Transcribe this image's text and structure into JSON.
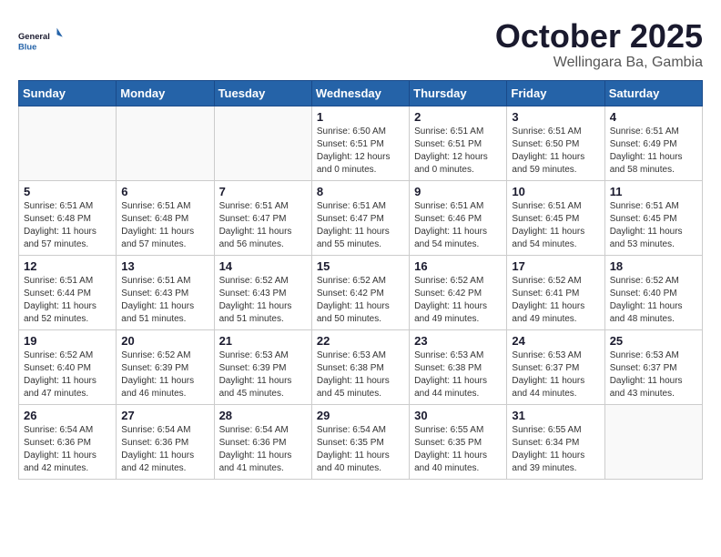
{
  "header": {
    "logo_line1": "General",
    "logo_line2": "Blue",
    "month": "October 2025",
    "location": "Wellingara Ba, Gambia"
  },
  "weekdays": [
    "Sunday",
    "Monday",
    "Tuesday",
    "Wednesday",
    "Thursday",
    "Friday",
    "Saturday"
  ],
  "weeks": [
    [
      {
        "day": "",
        "info": ""
      },
      {
        "day": "",
        "info": ""
      },
      {
        "day": "",
        "info": ""
      },
      {
        "day": "1",
        "info": "Sunrise: 6:50 AM\nSunset: 6:51 PM\nDaylight: 12 hours\nand 0 minutes."
      },
      {
        "day": "2",
        "info": "Sunrise: 6:51 AM\nSunset: 6:51 PM\nDaylight: 12 hours\nand 0 minutes."
      },
      {
        "day": "3",
        "info": "Sunrise: 6:51 AM\nSunset: 6:50 PM\nDaylight: 11 hours\nand 59 minutes."
      },
      {
        "day": "4",
        "info": "Sunrise: 6:51 AM\nSunset: 6:49 PM\nDaylight: 11 hours\nand 58 minutes."
      }
    ],
    [
      {
        "day": "5",
        "info": "Sunrise: 6:51 AM\nSunset: 6:48 PM\nDaylight: 11 hours\nand 57 minutes."
      },
      {
        "day": "6",
        "info": "Sunrise: 6:51 AM\nSunset: 6:48 PM\nDaylight: 11 hours\nand 57 minutes."
      },
      {
        "day": "7",
        "info": "Sunrise: 6:51 AM\nSunset: 6:47 PM\nDaylight: 11 hours\nand 56 minutes."
      },
      {
        "day": "8",
        "info": "Sunrise: 6:51 AM\nSunset: 6:47 PM\nDaylight: 11 hours\nand 55 minutes."
      },
      {
        "day": "9",
        "info": "Sunrise: 6:51 AM\nSunset: 6:46 PM\nDaylight: 11 hours\nand 54 minutes."
      },
      {
        "day": "10",
        "info": "Sunrise: 6:51 AM\nSunset: 6:45 PM\nDaylight: 11 hours\nand 54 minutes."
      },
      {
        "day": "11",
        "info": "Sunrise: 6:51 AM\nSunset: 6:45 PM\nDaylight: 11 hours\nand 53 minutes."
      }
    ],
    [
      {
        "day": "12",
        "info": "Sunrise: 6:51 AM\nSunset: 6:44 PM\nDaylight: 11 hours\nand 52 minutes."
      },
      {
        "day": "13",
        "info": "Sunrise: 6:51 AM\nSunset: 6:43 PM\nDaylight: 11 hours\nand 51 minutes."
      },
      {
        "day": "14",
        "info": "Sunrise: 6:52 AM\nSunset: 6:43 PM\nDaylight: 11 hours\nand 51 minutes."
      },
      {
        "day": "15",
        "info": "Sunrise: 6:52 AM\nSunset: 6:42 PM\nDaylight: 11 hours\nand 50 minutes."
      },
      {
        "day": "16",
        "info": "Sunrise: 6:52 AM\nSunset: 6:42 PM\nDaylight: 11 hours\nand 49 minutes."
      },
      {
        "day": "17",
        "info": "Sunrise: 6:52 AM\nSunset: 6:41 PM\nDaylight: 11 hours\nand 49 minutes."
      },
      {
        "day": "18",
        "info": "Sunrise: 6:52 AM\nSunset: 6:40 PM\nDaylight: 11 hours\nand 48 minutes."
      }
    ],
    [
      {
        "day": "19",
        "info": "Sunrise: 6:52 AM\nSunset: 6:40 PM\nDaylight: 11 hours\nand 47 minutes."
      },
      {
        "day": "20",
        "info": "Sunrise: 6:52 AM\nSunset: 6:39 PM\nDaylight: 11 hours\nand 46 minutes."
      },
      {
        "day": "21",
        "info": "Sunrise: 6:53 AM\nSunset: 6:39 PM\nDaylight: 11 hours\nand 45 minutes."
      },
      {
        "day": "22",
        "info": "Sunrise: 6:53 AM\nSunset: 6:38 PM\nDaylight: 11 hours\nand 45 minutes."
      },
      {
        "day": "23",
        "info": "Sunrise: 6:53 AM\nSunset: 6:38 PM\nDaylight: 11 hours\nand 44 minutes."
      },
      {
        "day": "24",
        "info": "Sunrise: 6:53 AM\nSunset: 6:37 PM\nDaylight: 11 hours\nand 44 minutes."
      },
      {
        "day": "25",
        "info": "Sunrise: 6:53 AM\nSunset: 6:37 PM\nDaylight: 11 hours\nand 43 minutes."
      }
    ],
    [
      {
        "day": "26",
        "info": "Sunrise: 6:54 AM\nSunset: 6:36 PM\nDaylight: 11 hours\nand 42 minutes."
      },
      {
        "day": "27",
        "info": "Sunrise: 6:54 AM\nSunset: 6:36 PM\nDaylight: 11 hours\nand 42 minutes."
      },
      {
        "day": "28",
        "info": "Sunrise: 6:54 AM\nSunset: 6:36 PM\nDaylight: 11 hours\nand 41 minutes."
      },
      {
        "day": "29",
        "info": "Sunrise: 6:54 AM\nSunset: 6:35 PM\nDaylight: 11 hours\nand 40 minutes."
      },
      {
        "day": "30",
        "info": "Sunrise: 6:55 AM\nSunset: 6:35 PM\nDaylight: 11 hours\nand 40 minutes."
      },
      {
        "day": "31",
        "info": "Sunrise: 6:55 AM\nSunset: 6:34 PM\nDaylight: 11 hours\nand 39 minutes."
      },
      {
        "day": "",
        "info": ""
      }
    ]
  ]
}
